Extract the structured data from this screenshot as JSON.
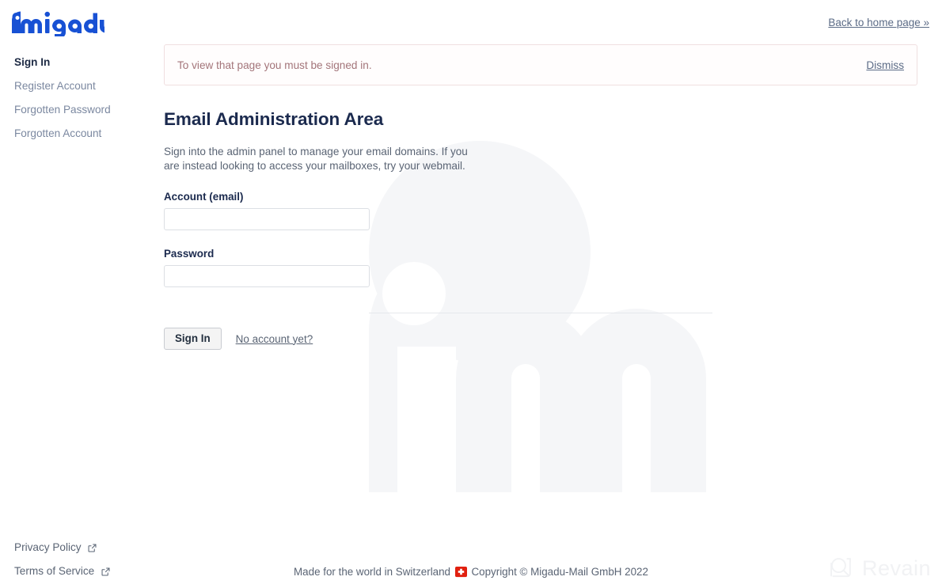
{
  "brand": {
    "logo_text": "migadu",
    "logo_color": "#1851d4",
    "watermark_color": "#f5f6f8"
  },
  "header": {
    "home_link_label": "Back to home page »"
  },
  "sidebar": {
    "items": [
      {
        "label": "Sign In",
        "active": true
      },
      {
        "label": "Register Account",
        "active": false
      },
      {
        "label": "Forgotten Password",
        "active": false
      },
      {
        "label": "Forgotten Account",
        "active": false
      }
    ]
  },
  "policy": {
    "links": [
      {
        "label": "Privacy Policy",
        "icon": "external-link-icon"
      },
      {
        "label": "Terms of Service",
        "icon": "external-link-icon"
      }
    ]
  },
  "alert": {
    "message": "To view that page you must be signed in.",
    "dismiss_label": "Dismiss",
    "text_color": "#a3757a",
    "border_color": "#f0dfe0"
  },
  "main": {
    "title": "Email Administration Area",
    "description": "Sign into the admin panel to manage your email domains. If you are instead looking to access your mailboxes, try your webmail.",
    "title_color": "#1b2a4e"
  },
  "form": {
    "account": {
      "label": "Account (email)",
      "value": "",
      "placeholder": ""
    },
    "password": {
      "label": "Password",
      "value": "",
      "placeholder": ""
    },
    "submit_label": "Sign In",
    "no_account_label": "No account yet?"
  },
  "footer": {
    "made_in": "Made for the world in Switzerland",
    "flag": "🇨🇭",
    "copyright": "Copyright © Migadu-Mail GmbH 2022"
  },
  "watermark": {
    "label": "Revain",
    "icon": "revain-logo-icon",
    "color": "#f1f2f4"
  }
}
